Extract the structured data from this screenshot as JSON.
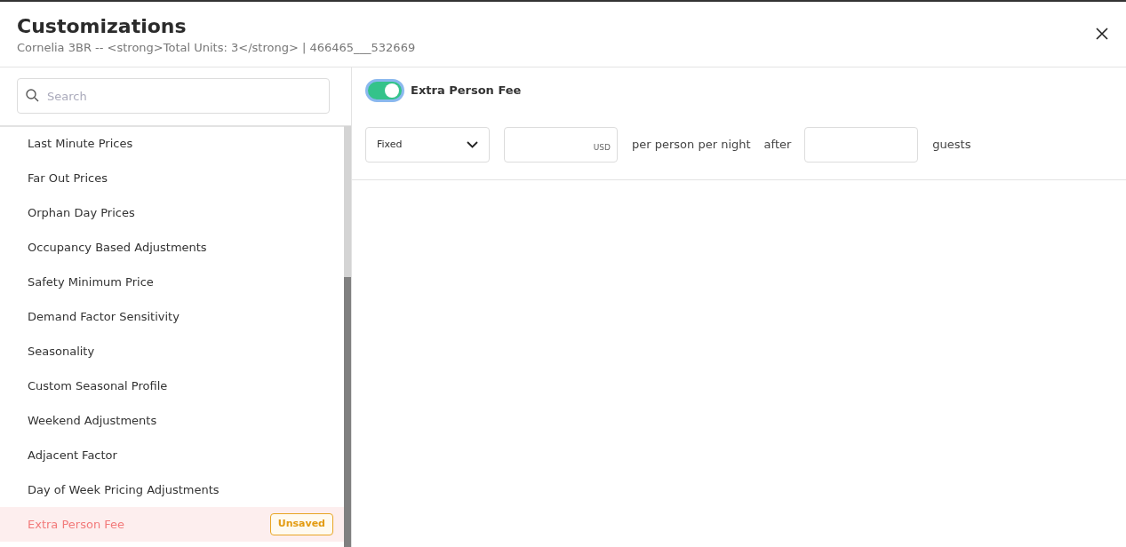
{
  "window": {
    "title": "Customizations",
    "subtitle": "Cornelia 3BR -- <strong>Total Units: 3</strong> | 466465___532669"
  },
  "search": {
    "placeholder": "Search"
  },
  "sidebar": {
    "items": [
      {
        "label": "Last Minute Prices",
        "selected": false
      },
      {
        "label": "Far Out Prices",
        "selected": false
      },
      {
        "label": "Orphan Day Prices",
        "selected": false
      },
      {
        "label": "Occupancy Based Adjustments",
        "selected": false
      },
      {
        "label": "Safety Minimum Price",
        "selected": false
      },
      {
        "label": "Demand Factor Sensitivity",
        "selected": false
      },
      {
        "label": "Seasonality",
        "selected": false
      },
      {
        "label": "Custom Seasonal Profile",
        "selected": false
      },
      {
        "label": "Weekend Adjustments",
        "selected": false
      },
      {
        "label": "Adjacent Factor",
        "selected": false
      },
      {
        "label": "Day of Week Pricing Adjustments",
        "selected": false
      },
      {
        "label": "Extra Person Fee",
        "selected": true,
        "badge": "Unsaved"
      }
    ]
  },
  "panel": {
    "toggle": {
      "label": "Extra Person Fee",
      "on": true
    },
    "fee_type": {
      "value": "Fixed"
    },
    "amount": {
      "unit": "USD"
    },
    "per_text": "per person per night",
    "after_text": "after",
    "guests_text": "guests"
  }
}
